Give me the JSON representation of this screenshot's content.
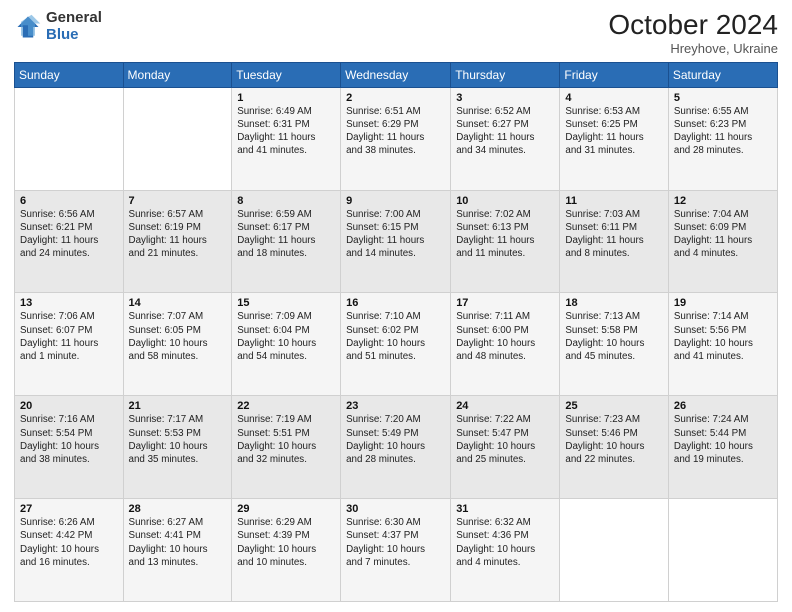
{
  "logo": {
    "general": "General",
    "blue": "Blue"
  },
  "title": {
    "month": "October 2024",
    "location": "Hreyhove, Ukraine"
  },
  "headers": [
    "Sunday",
    "Monday",
    "Tuesday",
    "Wednesday",
    "Thursday",
    "Friday",
    "Saturday"
  ],
  "weeks": [
    [
      {
        "day": "",
        "content": ""
      },
      {
        "day": "",
        "content": ""
      },
      {
        "day": "1",
        "content": "Sunrise: 6:49 AM\nSunset: 6:31 PM\nDaylight: 11 hours\nand 41 minutes."
      },
      {
        "day": "2",
        "content": "Sunrise: 6:51 AM\nSunset: 6:29 PM\nDaylight: 11 hours\nand 38 minutes."
      },
      {
        "day": "3",
        "content": "Sunrise: 6:52 AM\nSunset: 6:27 PM\nDaylight: 11 hours\nand 34 minutes."
      },
      {
        "day": "4",
        "content": "Sunrise: 6:53 AM\nSunset: 6:25 PM\nDaylight: 11 hours\nand 31 minutes."
      },
      {
        "day": "5",
        "content": "Sunrise: 6:55 AM\nSunset: 6:23 PM\nDaylight: 11 hours\nand 28 minutes."
      }
    ],
    [
      {
        "day": "6",
        "content": "Sunrise: 6:56 AM\nSunset: 6:21 PM\nDaylight: 11 hours\nand 24 minutes."
      },
      {
        "day": "7",
        "content": "Sunrise: 6:57 AM\nSunset: 6:19 PM\nDaylight: 11 hours\nand 21 minutes."
      },
      {
        "day": "8",
        "content": "Sunrise: 6:59 AM\nSunset: 6:17 PM\nDaylight: 11 hours\nand 18 minutes."
      },
      {
        "day": "9",
        "content": "Sunrise: 7:00 AM\nSunset: 6:15 PM\nDaylight: 11 hours\nand 14 minutes."
      },
      {
        "day": "10",
        "content": "Sunrise: 7:02 AM\nSunset: 6:13 PM\nDaylight: 11 hours\nand 11 minutes."
      },
      {
        "day": "11",
        "content": "Sunrise: 7:03 AM\nSunset: 6:11 PM\nDaylight: 11 hours\nand 8 minutes."
      },
      {
        "day": "12",
        "content": "Sunrise: 7:04 AM\nSunset: 6:09 PM\nDaylight: 11 hours\nand 4 minutes."
      }
    ],
    [
      {
        "day": "13",
        "content": "Sunrise: 7:06 AM\nSunset: 6:07 PM\nDaylight: 11 hours\nand 1 minute."
      },
      {
        "day": "14",
        "content": "Sunrise: 7:07 AM\nSunset: 6:05 PM\nDaylight: 10 hours\nand 58 minutes."
      },
      {
        "day": "15",
        "content": "Sunrise: 7:09 AM\nSunset: 6:04 PM\nDaylight: 10 hours\nand 54 minutes."
      },
      {
        "day": "16",
        "content": "Sunrise: 7:10 AM\nSunset: 6:02 PM\nDaylight: 10 hours\nand 51 minutes."
      },
      {
        "day": "17",
        "content": "Sunrise: 7:11 AM\nSunset: 6:00 PM\nDaylight: 10 hours\nand 48 minutes."
      },
      {
        "day": "18",
        "content": "Sunrise: 7:13 AM\nSunset: 5:58 PM\nDaylight: 10 hours\nand 45 minutes."
      },
      {
        "day": "19",
        "content": "Sunrise: 7:14 AM\nSunset: 5:56 PM\nDaylight: 10 hours\nand 41 minutes."
      }
    ],
    [
      {
        "day": "20",
        "content": "Sunrise: 7:16 AM\nSunset: 5:54 PM\nDaylight: 10 hours\nand 38 minutes."
      },
      {
        "day": "21",
        "content": "Sunrise: 7:17 AM\nSunset: 5:53 PM\nDaylight: 10 hours\nand 35 minutes."
      },
      {
        "day": "22",
        "content": "Sunrise: 7:19 AM\nSunset: 5:51 PM\nDaylight: 10 hours\nand 32 minutes."
      },
      {
        "day": "23",
        "content": "Sunrise: 7:20 AM\nSunset: 5:49 PM\nDaylight: 10 hours\nand 28 minutes."
      },
      {
        "day": "24",
        "content": "Sunrise: 7:22 AM\nSunset: 5:47 PM\nDaylight: 10 hours\nand 25 minutes."
      },
      {
        "day": "25",
        "content": "Sunrise: 7:23 AM\nSunset: 5:46 PM\nDaylight: 10 hours\nand 22 minutes."
      },
      {
        "day": "26",
        "content": "Sunrise: 7:24 AM\nSunset: 5:44 PM\nDaylight: 10 hours\nand 19 minutes."
      }
    ],
    [
      {
        "day": "27",
        "content": "Sunrise: 6:26 AM\nSunset: 4:42 PM\nDaylight: 10 hours\nand 16 minutes."
      },
      {
        "day": "28",
        "content": "Sunrise: 6:27 AM\nSunset: 4:41 PM\nDaylight: 10 hours\nand 13 minutes."
      },
      {
        "day": "29",
        "content": "Sunrise: 6:29 AM\nSunset: 4:39 PM\nDaylight: 10 hours\nand 10 minutes."
      },
      {
        "day": "30",
        "content": "Sunrise: 6:30 AM\nSunset: 4:37 PM\nDaylight: 10 hours\nand 7 minutes."
      },
      {
        "day": "31",
        "content": "Sunrise: 6:32 AM\nSunset: 4:36 PM\nDaylight: 10 hours\nand 4 minutes."
      },
      {
        "day": "",
        "content": ""
      },
      {
        "day": "",
        "content": ""
      }
    ]
  ]
}
